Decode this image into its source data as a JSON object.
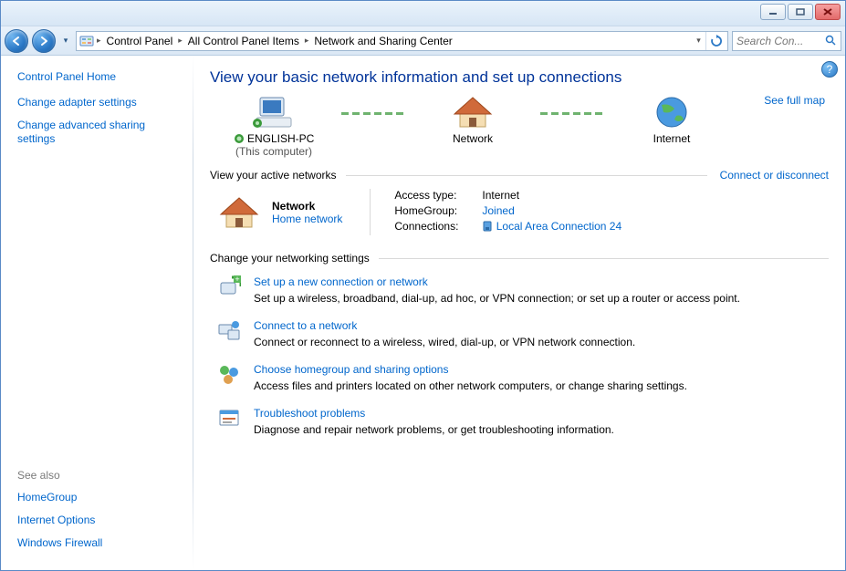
{
  "breadcrumb": {
    "items": [
      "Control Panel",
      "All Control Panel Items",
      "Network and Sharing Center"
    ]
  },
  "search": {
    "placeholder": "Search Con..."
  },
  "sidebar": {
    "home": "Control Panel Home",
    "links": [
      "Change adapter settings",
      "Change advanced sharing settings"
    ],
    "seealso_label": "See also",
    "seealso": [
      "HomeGroup",
      "Internet Options",
      "Windows Firewall"
    ]
  },
  "main": {
    "title": "View your basic network information and set up connections",
    "see_full_map": "See full map",
    "map": {
      "node1_label": "ENGLISH-PC",
      "node1_sub": "(This computer)",
      "node2_label": "Network",
      "node3_label": "Internet"
    },
    "active_header": "View your active networks",
    "connect_disconnect": "Connect or disconnect",
    "network": {
      "name": "Network",
      "type": "Home network",
      "access_label": "Access type:",
      "access_value": "Internet",
      "homegroup_label": "HomeGroup:",
      "homegroup_value": "Joined",
      "connections_label": "Connections:",
      "connections_value": "Local Area Connection 24"
    },
    "change_header": "Change your networking settings",
    "tasks": [
      {
        "title": "Set up a new connection or network",
        "desc": "Set up a wireless, broadband, dial-up, ad hoc, or VPN connection; or set up a router or access point."
      },
      {
        "title": "Connect to a network",
        "desc": "Connect or reconnect to a wireless, wired, dial-up, or VPN network connection."
      },
      {
        "title": "Choose homegroup and sharing options",
        "desc": "Access files and printers located on other network computers, or change sharing settings."
      },
      {
        "title": "Troubleshoot problems",
        "desc": "Diagnose and repair network problems, or get troubleshooting information."
      }
    ]
  }
}
